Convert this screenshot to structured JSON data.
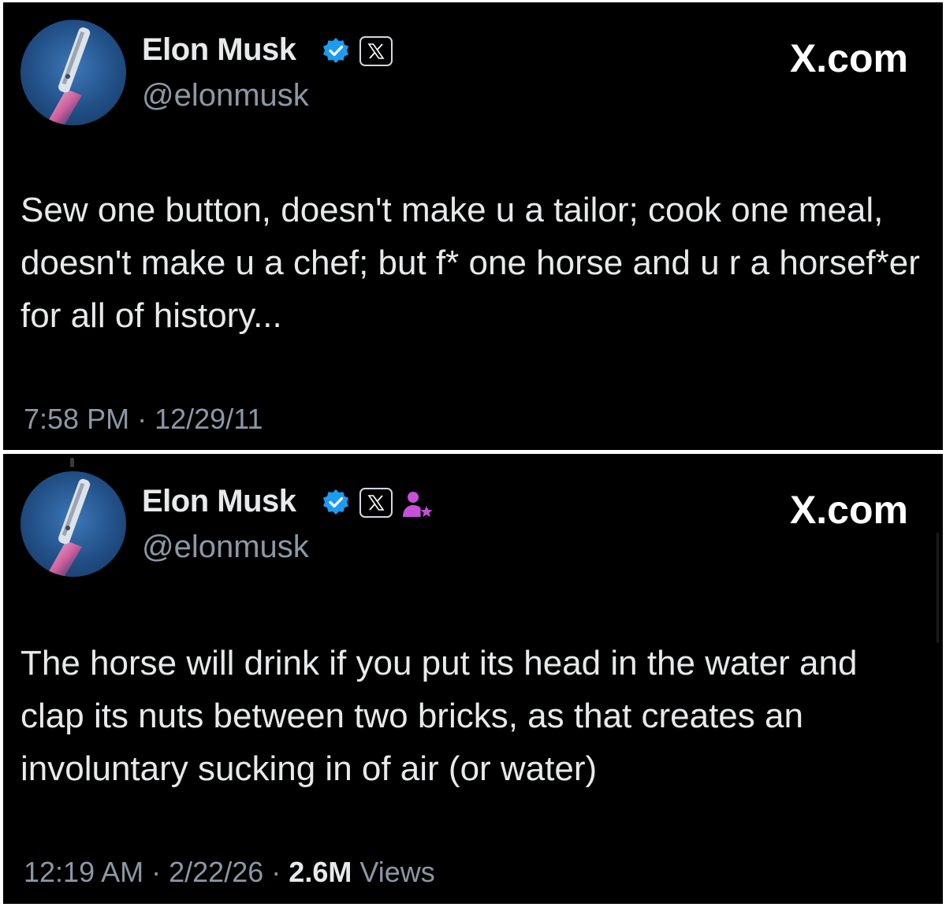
{
  "tweets": [
    {
      "author": {
        "name": "Elon Musk",
        "handle": "@elonmusk"
      },
      "site_label": "X.com",
      "badges": [
        "verified-icon",
        "x-badge-icon"
      ],
      "text": "Sew one button, doesn't make u a tailor; cook one meal, doesn't make u a chef; but f* one horse and u r a horsef*er for all of history...",
      "time": "7:58 PM",
      "date": "12/29/11"
    },
    {
      "author": {
        "name": "Elon Musk",
        "handle": "@elonmusk"
      },
      "site_label": "X.com",
      "badges": [
        "verified-icon",
        "x-badge-icon",
        "affiliate-person-icon"
      ],
      "text": "The horse will drink if you put its head in the water and clap its nuts between two bricks, as that creates an involuntary sucking in of air (or water)",
      "time": "12:19 AM",
      "date": "2/22/26",
      "views_count": "2.6M",
      "views_label": "Views"
    }
  ],
  "separator": "·",
  "colors": {
    "background": "#000000",
    "text_primary": "#e7e9ea",
    "text_secondary": "#8b98a5",
    "verified_blue": "#1d9bf0",
    "affiliate_purple": "#c650d8"
  }
}
